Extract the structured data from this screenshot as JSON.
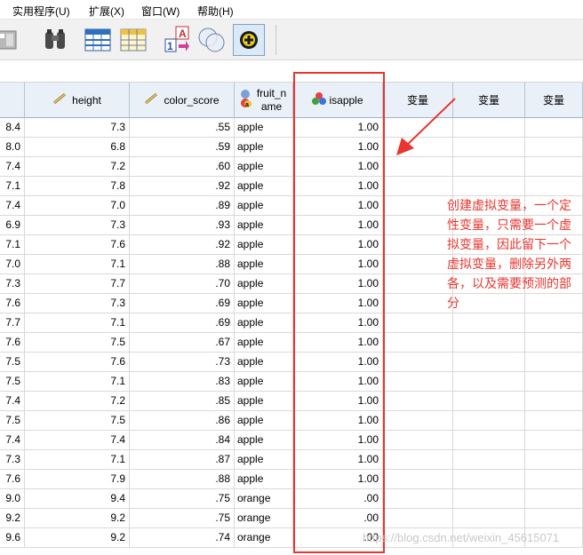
{
  "menu": [
    {
      "label": "实用程序(U)",
      "name": "menu-utilities"
    },
    {
      "label": "扩展(X)",
      "name": "menu-extensions"
    },
    {
      "label": "窗口(W)",
      "name": "menu-window"
    },
    {
      "label": "帮助(H)",
      "name": "menu-help"
    }
  ],
  "toolbar": {
    "icons": [
      "goto-variable-icon",
      "find-binoculars-icon",
      "split-file-icon",
      "select-cases-icon",
      "value-labels-icon",
      "use-sets-icon",
      "spelling-add-icon"
    ]
  },
  "grid": {
    "columns": [
      {
        "label": "",
        "type": "num"
      },
      {
        "label": "height",
        "type": "scale"
      },
      {
        "label": "color_score",
        "type": "scale"
      },
      {
        "label": "fruit_n ame",
        "type": "nominal"
      },
      {
        "label": "isapple",
        "type": "nominal-num"
      },
      {
        "label": "变量",
        "type": "blank"
      },
      {
        "label": "变量",
        "type": "blank"
      },
      {
        "label": "变量",
        "type": "blank"
      }
    ],
    "rows": [
      [
        "8.4",
        "7.3",
        ".55",
        "apple",
        "1.00"
      ],
      [
        "8.0",
        "6.8",
        ".59",
        "apple",
        "1.00"
      ],
      [
        "7.4",
        "7.2",
        ".60",
        "apple",
        "1.00"
      ],
      [
        "7.1",
        "7.8",
        ".92",
        "apple",
        "1.00"
      ],
      [
        "7.4",
        "7.0",
        ".89",
        "apple",
        "1.00"
      ],
      [
        "6.9",
        "7.3",
        ".93",
        "apple",
        "1.00"
      ],
      [
        "7.1",
        "7.6",
        ".92",
        "apple",
        "1.00"
      ],
      [
        "7.0",
        "7.1",
        ".88",
        "apple",
        "1.00"
      ],
      [
        "7.3",
        "7.7",
        ".70",
        "apple",
        "1.00"
      ],
      [
        "7.6",
        "7.3",
        ".69",
        "apple",
        "1.00"
      ],
      [
        "7.7",
        "7.1",
        ".69",
        "apple",
        "1.00"
      ],
      [
        "7.6",
        "7.5",
        ".67",
        "apple",
        "1.00"
      ],
      [
        "7.5",
        "7.6",
        ".73",
        "apple",
        "1.00"
      ],
      [
        "7.5",
        "7.1",
        ".83",
        "apple",
        "1.00"
      ],
      [
        "7.4",
        "7.2",
        ".85",
        "apple",
        "1.00"
      ],
      [
        "7.5",
        "7.5",
        ".86",
        "apple",
        "1.00"
      ],
      [
        "7.4",
        "7.4",
        ".84",
        "apple",
        "1.00"
      ],
      [
        "7.3",
        "7.1",
        ".87",
        "apple",
        "1.00"
      ],
      [
        "7.6",
        "7.9",
        ".88",
        "apple",
        "1.00"
      ],
      [
        "9.0",
        "9.4",
        ".75",
        "orange",
        ".00"
      ],
      [
        "9.2",
        "9.2",
        ".75",
        "orange",
        ".00"
      ],
      [
        "9.6",
        "9.2",
        ".74",
        "orange",
        ".00"
      ]
    ]
  },
  "annotation": {
    "text": "创建虚拟变量，一个定性变量，只需要一个虚拟变量，因此留下一个虚拟变量，删除另外两各，以及需要预测的部分",
    "color": "#e8352f"
  },
  "watermark": "https://blog.csdn.net/weixin_45615071"
}
